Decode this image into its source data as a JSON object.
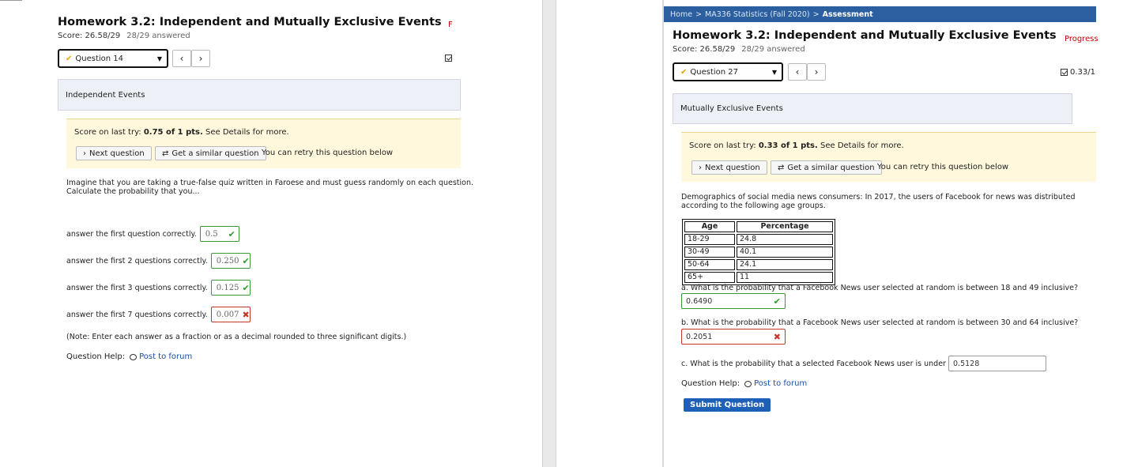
{
  "left": {
    "title": "Homework 3.2: Independent and Mutually Exclusive Events",
    "score": "Score: 26.58/29",
    "answered": "28/29 answered",
    "progress_fragment": "F",
    "question_select": "Question 14",
    "category": "Independent Events",
    "feedback": {
      "prefix": "Score on last try: ",
      "score": "0.75 of 1 pts.",
      "suffix": " See Details for more.",
      "next_btn": "Next question",
      "similar_btn": "Get a similar question",
      "retry_text": "You can retry this question below"
    },
    "question_text_1": "Imagine that you are taking a true-false quiz written in Faroese and must guess randomly on each question.",
    "question_text_2": "Calculate the probability that you...",
    "answers": [
      {
        "label": "answer the first question correctly.",
        "value": "0.5",
        "status": "correct"
      },
      {
        "label": "answer the first 2 questions correctly.",
        "value": "0.250",
        "status": "correct"
      },
      {
        "label": "answer the first 3 questions correctly.",
        "value": "0.125",
        "status": "correct"
      },
      {
        "label": "answer the first 7 questions correctly.",
        "value": "0.007",
        "status": "incorrect"
      }
    ],
    "note": "(Note: Enter each answer as a fraction or as a decimal rounded to three significant digits.)",
    "help_label": "Question Help:",
    "forum_link": "Post to forum"
  },
  "right": {
    "breadcrumb": [
      "Home",
      "MA336 Statistics (Fall 2020)",
      "Assessment"
    ],
    "breadcrumb_sep": ">",
    "title": "Homework 3.2: Independent and Mutually Exclusive Events",
    "score": "Score: 26.58/29",
    "answered": "28/29 answered",
    "progress": "Progress",
    "question_select": "Question 27",
    "question_score": "0.33/1",
    "category": "Mutually Exclusive Events",
    "feedback": {
      "prefix": "Score on last try: ",
      "score": "0.33 of 1 pts.",
      "suffix": " See Details for more.",
      "next_btn": "Next question",
      "similar_btn": "Get a similar question",
      "retry_text": "You can retry this question below"
    },
    "question_text_1": "Demographics of social media news consumers: In 2017, the users of Facebook for news was distributed",
    "question_text_2": "according to the following age groups.",
    "table": {
      "headers": [
        "Age",
        "Percentage"
      ],
      "rows": [
        [
          "18-29",
          "24.8"
        ],
        [
          "30-49",
          "40.1"
        ],
        [
          "50-64",
          "24.1"
        ],
        [
          "65+",
          "11"
        ]
      ]
    },
    "part_a": {
      "label": "a. What is the probability that a Facebook News user selected at random is between 18 and 49 inclusive?",
      "value": "0.6490",
      "status": "correct"
    },
    "part_b": {
      "label": "b. What is the probability that a Facebook News user selected at random is between 30 and 64 inclusive?",
      "value": "0.2051",
      "status": "incorrect"
    },
    "part_c": {
      "label": "c. What is the probability that a selected Facebook News user is under 65?",
      "value": "0.5128"
    },
    "help_label": "Question Help:",
    "forum_link": "Post to forum",
    "submit": "Submit Question"
  },
  "colors": {
    "breadcrumb_bg": "#2b5fa0",
    "feedback_bg": "#fff8dc",
    "category_bg": "#eef0f7",
    "correct": "#3a9a3a",
    "incorrect": "#c0392b",
    "submit_bg": "#1e5fb8",
    "progress": "#cc0000"
  }
}
